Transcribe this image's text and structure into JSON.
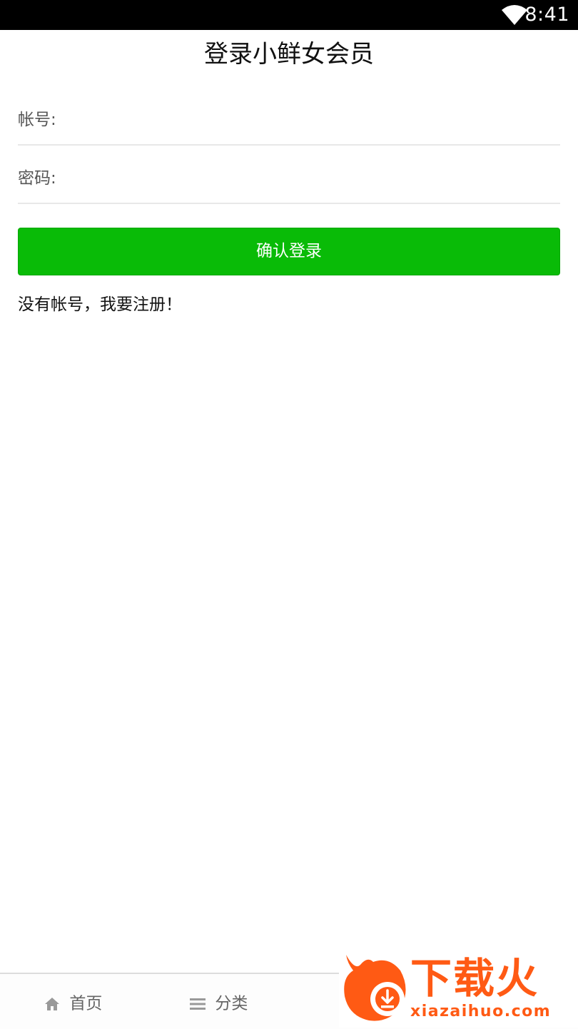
{
  "status_bar": {
    "time": "8:41",
    "wifi_icon": "wifi-icon"
  },
  "header": {
    "title": "登录小鲜女会员"
  },
  "form": {
    "account_label": "帐号:",
    "account_value": "",
    "password_label": "密码:",
    "password_value": "",
    "submit_label": "确认登录",
    "register_link": "没有帐号，我要注册！"
  },
  "bottom_nav": {
    "items": [
      {
        "label": "首页",
        "icon": "home-icon"
      },
      {
        "label": "分类",
        "icon": "menu-icon"
      }
    ]
  },
  "watermark": {
    "brand": "下载火",
    "domain": "xiazaihuo.com"
  },
  "colors": {
    "accent_green": "#09bb07",
    "watermark_orange": "#ff5a14",
    "status_bar": "#000000"
  }
}
